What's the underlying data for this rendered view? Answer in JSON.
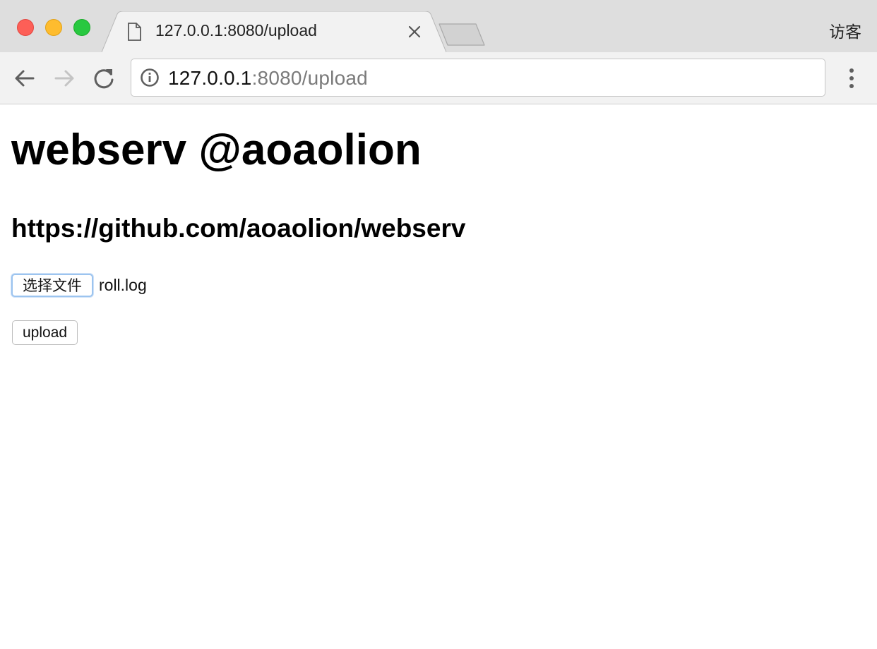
{
  "browser": {
    "tab": {
      "title": "127.0.0.1:8080/upload"
    },
    "profile_label": "访客",
    "address_bar": {
      "host": "127.0.0.1",
      "rest": ":8080/upload"
    },
    "colors": {
      "close": "#fd5f57",
      "minimize": "#febc2e",
      "maximize": "#28c840"
    }
  },
  "page": {
    "heading": "webserv @aoaolion",
    "subheading": "https://github.com/aoaolion/webserv",
    "file_input": {
      "button_label": "选择文件",
      "selected_file": "roll.log"
    },
    "upload_button_label": "upload"
  }
}
